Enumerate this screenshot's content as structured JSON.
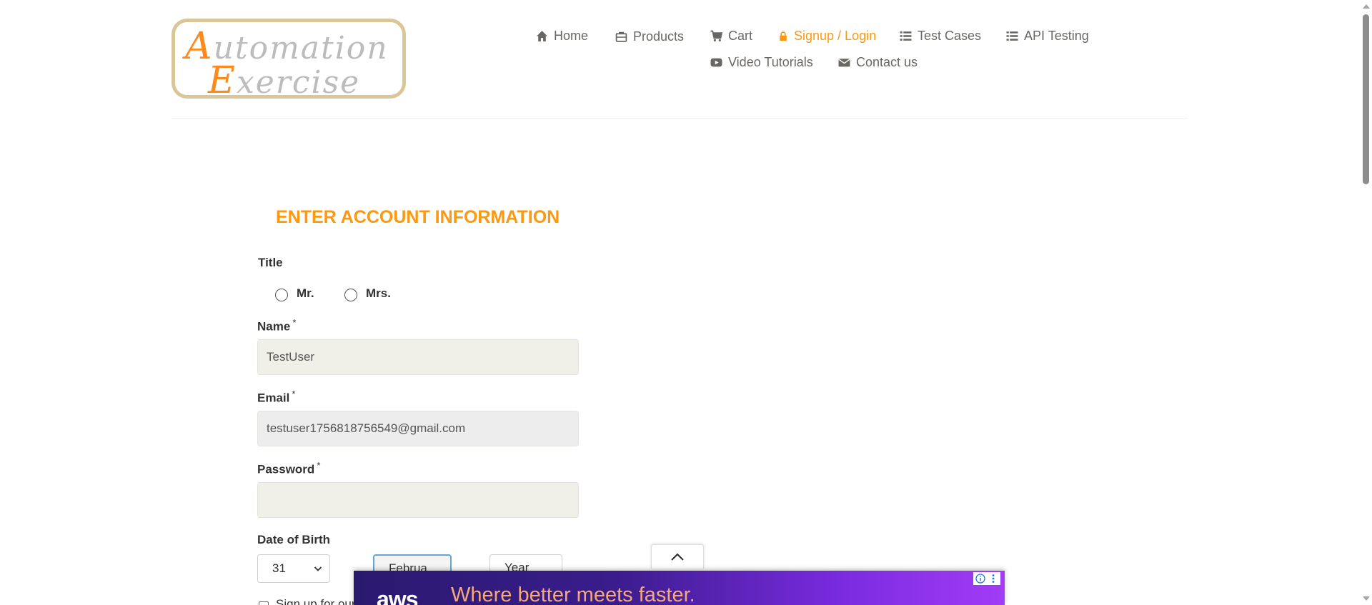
{
  "logo": {
    "line1_cap": "A",
    "line1_rest": "utomation",
    "line2_cap": "E",
    "line2_rest": "xercise"
  },
  "nav": {
    "items": [
      {
        "label": "Home",
        "icon": "home-icon"
      },
      {
        "label": "Products",
        "icon": "products-icon"
      },
      {
        "label": "Cart",
        "icon": "cart-icon"
      },
      {
        "label": "Signup / Login",
        "icon": "lock-icon",
        "active": true
      },
      {
        "label": "Test Cases",
        "icon": "list-icon"
      },
      {
        "label": "API Testing",
        "icon": "list-icon"
      },
      {
        "label": "Video Tutorials",
        "icon": "youtube-icon"
      },
      {
        "label": "Contact us",
        "icon": "envelope-icon"
      }
    ],
    "active_color": "#fe980f"
  },
  "form": {
    "heading": "ENTER ACCOUNT INFORMATION",
    "title_label": "Title",
    "title_options": [
      "Mr.",
      "Mrs."
    ],
    "name_label": "Name",
    "name_value": "TestUser",
    "email_label": "Email",
    "email_value": "testuser1756818756549@gmail.com",
    "password_label": "Password",
    "password_value": "",
    "required_mark": "*",
    "dob_label": "Date of Birth",
    "dob_day": "31",
    "dob_month": "Februa",
    "dob_year": "Year",
    "newsletter_label": "Sign up for our"
  },
  "ad": {
    "logo_text": "aws",
    "headline": "Where better meets faster.",
    "info_icon": "info-icon",
    "menu_icon": "kebab-icon"
  },
  "colors": {
    "accent": "#fe980f",
    "field_bg": "#f0f0e9",
    "logo_orange": "#fe8a1c"
  }
}
